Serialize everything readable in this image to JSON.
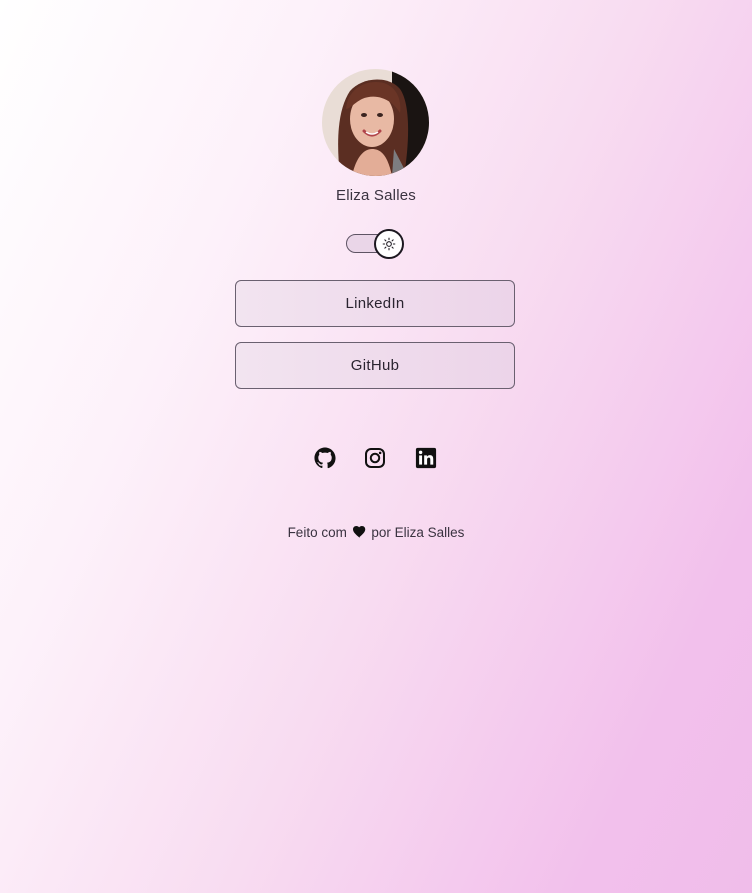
{
  "profile": {
    "name": "Eliza Salles",
    "avatar_alt": "avatar-photo"
  },
  "theme_toggle": {
    "icon": "sun-icon",
    "state": "light"
  },
  "links": [
    {
      "label": "LinkedIn"
    },
    {
      "label": "GitHub"
    }
  ],
  "social": {
    "icons": [
      "github-icon",
      "instagram-icon",
      "linkedin-icon"
    ]
  },
  "footer": {
    "prefix": "Feito com",
    "heart_icon": "heart-icon",
    "suffix": "por Eliza Salles"
  },
  "colors": {
    "gradient_start": "#ffffff",
    "gradient_end": "#f0bdea",
    "button_border": "#6a6070",
    "text": "#2a2430"
  }
}
